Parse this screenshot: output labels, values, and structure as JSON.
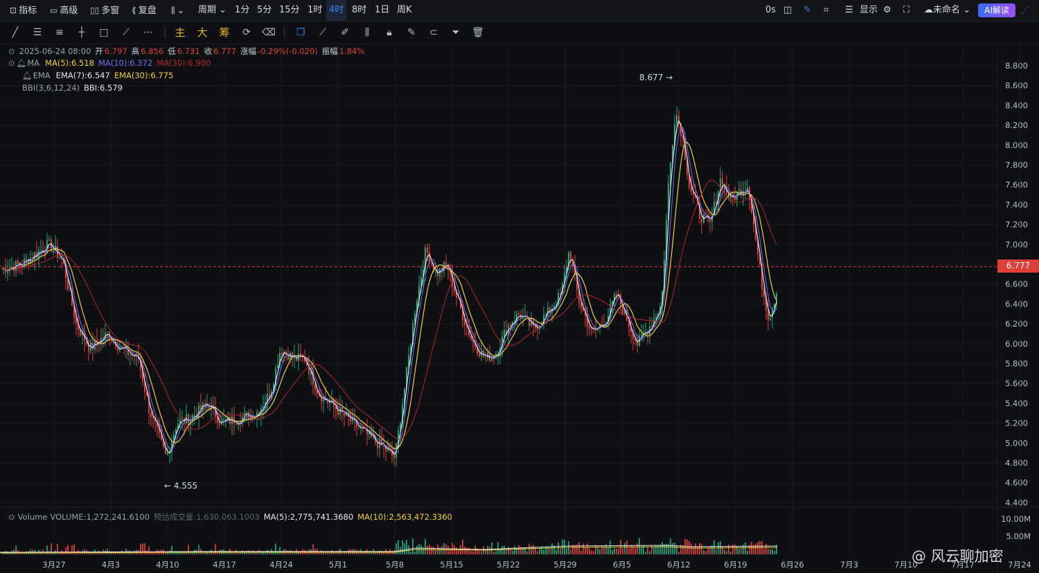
{
  "topbar": {
    "indicator": "指标",
    "advanced": "高级",
    "multi_window": "多窗",
    "replay": "复盘",
    "period": "周期",
    "intervals": [
      "1分",
      "5分",
      "15分",
      "1时",
      "4时",
      "8时",
      "1日",
      "周K"
    ],
    "active_interval": "4时",
    "timer": "0s",
    "display": "显示",
    "unnamed": "未命名",
    "ai_label": "AI解读"
  },
  "drawtools": {
    "main": "主",
    "big": "大",
    "chip": "筹"
  },
  "ohlc": {
    "date": "2025-06-24 08:00",
    "open_label": "开",
    "open": "6.797",
    "high_label": "高",
    "high": "6.856",
    "low_label": "低",
    "low": "6.731",
    "close_label": "收",
    "close": "6.777",
    "change_label": "涨幅",
    "change": "-0.29%(-0.020)",
    "amp_label": "振幅",
    "amp": "1.84%"
  },
  "ma": {
    "name": "MA",
    "ma5": "MA(5):6.518",
    "ma10": "MA(10):6.372",
    "ma30": "MA(30):6.900"
  },
  "ema": {
    "name": "EMA",
    "ema7": "EMA(7):6.547",
    "ema30": "EMA(30):6.775"
  },
  "bbi": {
    "name": "BBI(3,6,12,24)",
    "value": "BBI:6.579"
  },
  "volume": {
    "name": "Volume",
    "vol": "VOLUME:1,272,241.6100",
    "est": "预估成交量:1,630,063.1003",
    "ma5": "MA(5):2,775,741.3680",
    "ma10": "MA(10):2,563,472.3360"
  },
  "current_price": "6.777",
  "colors": {
    "up": "#1fa77a",
    "down": "#e0403a",
    "ma5": "#f0d040",
    "ma10": "#6a6ef5",
    "ma30": "#b3262f",
    "white": "#e8e8ee",
    "accent": "#3b82f6"
  },
  "chart_data": {
    "type": "candlestick",
    "price_ticks": [
      "8.800",
      "8.600",
      "8.400",
      "8.200",
      "8.000",
      "7.800",
      "7.600",
      "7.400",
      "7.200",
      "7.000",
      "6.800",
      "6.600",
      "6.400",
      "6.200",
      "6.000",
      "5.800",
      "5.600",
      "5.400",
      "5.200",
      "5.000",
      "4.800",
      "4.600",
      "4.400"
    ],
    "ylim": [
      4.3,
      8.9
    ],
    "volume_ticks": [
      "10.00M",
      "5.00M"
    ],
    "x_ticks": [
      "3月27",
      "4月3",
      "4月10",
      "4月17",
      "4月24",
      "5月1",
      "5月8",
      "5月15",
      "5月22",
      "5月29",
      "6月5",
      "6月12",
      "6月19",
      "6月26",
      "7月3",
      "7月10",
      "7月17",
      "7月24"
    ],
    "high_annotation": "8.677",
    "low_annotation": "4.555",
    "current_price": 6.777,
    "close_path": [
      {
        "x": 0,
        "y": 6.75
      },
      {
        "x": 30,
        "y": 6.8
      },
      {
        "x": 50,
        "y": 6.9
      },
      {
        "x": 70,
        "y": 7.0
      },
      {
        "x": 90,
        "y": 6.85
      },
      {
        "x": 110,
        "y": 6.2
      },
      {
        "x": 130,
        "y": 5.95
      },
      {
        "x": 155,
        "y": 6.1
      },
      {
        "x": 175,
        "y": 5.95
      },
      {
        "x": 200,
        "y": 5.85
      },
      {
        "x": 215,
        "y": 5.35
      },
      {
        "x": 230,
        "y": 5.05
      },
      {
        "x": 240,
        "y": 4.85
      },
      {
        "x": 255,
        "y": 5.2
      },
      {
        "x": 275,
        "y": 5.25
      },
      {
        "x": 300,
        "y": 5.4
      },
      {
        "x": 320,
        "y": 5.2
      },
      {
        "x": 345,
        "y": 5.25
      },
      {
        "x": 370,
        "y": 5.3
      },
      {
        "x": 390,
        "y": 5.5
      },
      {
        "x": 405,
        "y": 5.95
      },
      {
        "x": 425,
        "y": 5.85
      },
      {
        "x": 440,
        "y": 5.85
      },
      {
        "x": 460,
        "y": 5.5
      },
      {
        "x": 485,
        "y": 5.35
      },
      {
        "x": 510,
        "y": 5.2
      },
      {
        "x": 535,
        "y": 5.05
      },
      {
        "x": 555,
        "y": 4.95
      },
      {
        "x": 570,
        "y": 4.85
      },
      {
        "x": 585,
        "y": 5.6
      },
      {
        "x": 600,
        "y": 6.4
      },
      {
        "x": 615,
        "y": 6.95
      },
      {
        "x": 630,
        "y": 6.7
      },
      {
        "x": 645,
        "y": 6.8
      },
      {
        "x": 660,
        "y": 6.45
      },
      {
        "x": 680,
        "y": 6.05
      },
      {
        "x": 700,
        "y": 5.85
      },
      {
        "x": 715,
        "y": 5.9
      },
      {
        "x": 735,
        "y": 6.2
      },
      {
        "x": 750,
        "y": 6.3
      },
      {
        "x": 770,
        "y": 6.15
      },
      {
        "x": 790,
        "y": 6.3
      },
      {
        "x": 810,
        "y": 6.5
      },
      {
        "x": 822,
        "y": 6.95
      },
      {
        "x": 835,
        "y": 6.45
      },
      {
        "x": 855,
        "y": 6.1
      },
      {
        "x": 875,
        "y": 6.25
      },
      {
        "x": 890,
        "y": 6.5
      },
      {
        "x": 905,
        "y": 6.25
      },
      {
        "x": 920,
        "y": 6.0
      },
      {
        "x": 940,
        "y": 6.2
      },
      {
        "x": 955,
        "y": 6.4
      },
      {
        "x": 965,
        "y": 7.6
      },
      {
        "x": 975,
        "y": 8.35
      },
      {
        "x": 985,
        "y": 8.1
      },
      {
        "x": 995,
        "y": 7.6
      },
      {
        "x": 1010,
        "y": 7.3
      },
      {
        "x": 1025,
        "y": 7.2
      },
      {
        "x": 1040,
        "y": 7.65
      },
      {
        "x": 1055,
        "y": 7.45
      },
      {
        "x": 1070,
        "y": 7.55
      },
      {
        "x": 1080,
        "y": 7.6
      },
      {
        "x": 1090,
        "y": 7.1
      },
      {
        "x": 1100,
        "y": 6.6
      },
      {
        "x": 1110,
        "y": 6.25
      },
      {
        "x": 1122,
        "y": 6.55
      }
    ]
  },
  "watermark": "@ 风云聊加密"
}
